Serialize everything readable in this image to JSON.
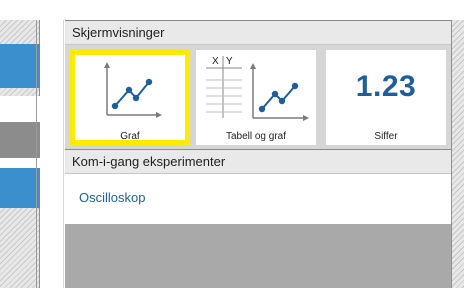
{
  "sections": {
    "displays_title": "Skjermvisninger",
    "experiments_title": "Kom-i-gang eksperimenter"
  },
  "tiles": [
    {
      "label": "Graf",
      "icon": "graph-icon",
      "selected": true
    },
    {
      "label": "Tabell og graf",
      "icon": "table-graph-icon",
      "table_header_x": "X",
      "table_header_y": "Y"
    },
    {
      "label": "Siffer",
      "icon": "digits-icon",
      "value": "1.23"
    }
  ],
  "experiments": [
    {
      "label": "Oscilloskop"
    }
  ],
  "colors": {
    "selection": "#ffea00",
    "accent_blue": "#1f5f99",
    "sidebar_blue": "#3a8fcc",
    "sidebar_gray": "#8c8c8c",
    "bottom_gray": "#a9a9a9"
  }
}
